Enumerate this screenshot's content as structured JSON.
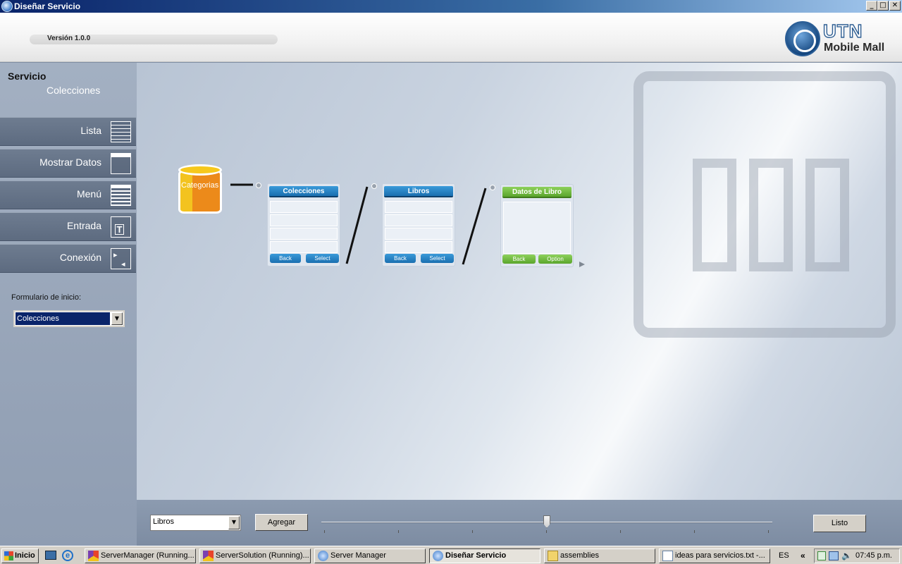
{
  "window": {
    "title": "Diseñar Servicio",
    "controls": [
      "_",
      "□",
      "✕"
    ]
  },
  "header": {
    "version": "Versión 1.0.0",
    "logo_top": "UTN",
    "logo_bottom": "Mobile Mall"
  },
  "sidebar": {
    "title": "Servicio",
    "subtitle": "Colecciones",
    "items": [
      {
        "label": "Lista",
        "icon": "list-icon"
      },
      {
        "label": "Mostrar Datos",
        "icon": "form-icon"
      },
      {
        "label": "Menú",
        "icon": "menu-icon"
      },
      {
        "label": "Entrada",
        "icon": "input-icon"
      },
      {
        "label": "Conexión",
        "icon": "connection-icon"
      }
    ],
    "start_form_label": "Formulario de inicio:",
    "start_form_value": "Colecciones"
  },
  "canvas": {
    "datasource": "Categorias",
    "forms": [
      {
        "title": "Colecciones",
        "buttons": [
          "Back",
          "Select"
        ],
        "color": "#1a6fb0"
      },
      {
        "title": "Libros",
        "buttons": [
          "Back",
          "Select"
        ],
        "color": "#1a6fb0"
      },
      {
        "title": "Datos de Libro",
        "buttons": [
          "Back",
          "Option"
        ],
        "color": "#5aa52c"
      }
    ]
  },
  "bottom": {
    "form_select": "Libros",
    "add_button": "Agregar",
    "done_button": "Listo"
  },
  "taskbar": {
    "start": "Inicio",
    "tasks": [
      "ServerManager (Running...",
      "ServerSolution (Running)...",
      "Server Manager",
      "Diseñar Servicio",
      "assemblies",
      "ideas para servicios.txt -..."
    ],
    "lang": "ES",
    "chevron": "«",
    "clock": "07:45 p.m."
  }
}
